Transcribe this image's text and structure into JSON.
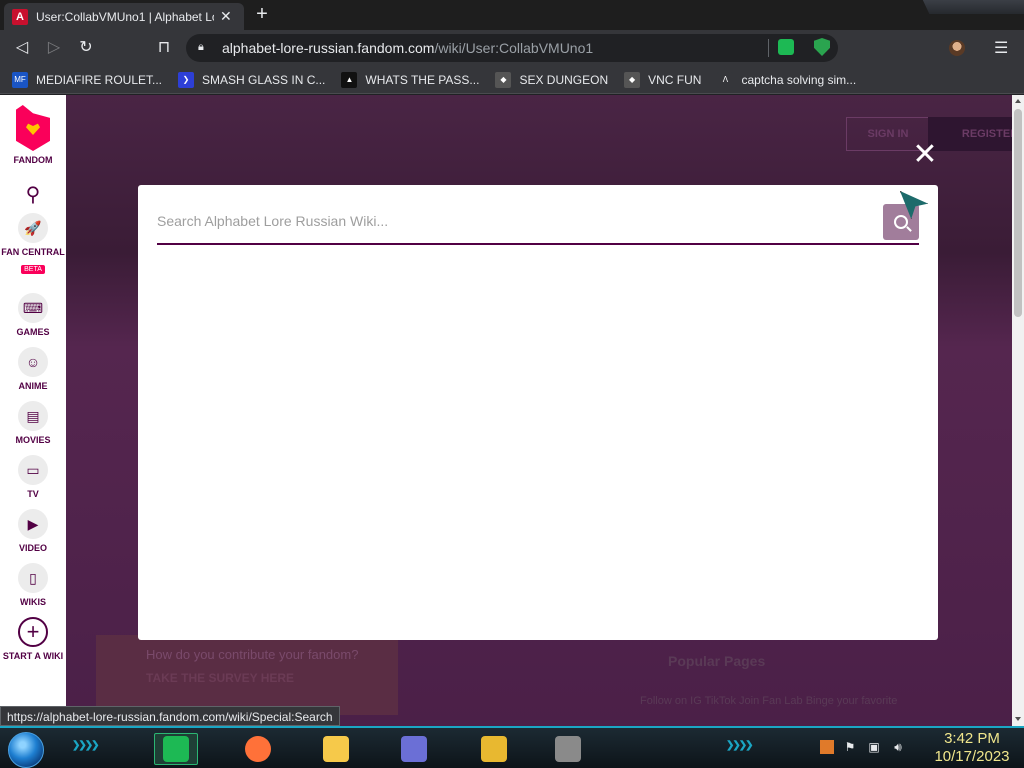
{
  "browser": {
    "tab": {
      "title": "User:CollabVMUno1 | Alphabet Lo",
      "close": "✕",
      "favicon_text": "A"
    },
    "new_tab": "+",
    "url": {
      "domain": "alphabet-lore-russian.fandom.com",
      "path": "/wiki/User:CollabVMUno1"
    },
    "bookmarks": [
      {
        "label": "MEDIAFIRE ROULET...",
        "icon": "mediafire-icon",
        "color": "#1a55c4",
        "icon_text": "MF"
      },
      {
        "label": "SMASH GLASS IN C...",
        "icon": "chevron-icon",
        "color": "#2d3fd6",
        "icon_text": "❯"
      },
      {
        "label": "WHATS THE PASS...",
        "icon": "dark-box-icon",
        "color": "#111111",
        "icon_text": "▲"
      },
      {
        "label": "SEX DUNGEON",
        "icon": "cube-icon",
        "color": "#555555",
        "icon_text": "◆"
      },
      {
        "label": "VNC FUN",
        "icon": "cube-icon",
        "color": "#555555",
        "icon_text": "◆"
      },
      {
        "label": "captcha solving sim...",
        "icon": "a-logo-icon",
        "color": "#35363a",
        "icon_text": "Λ"
      }
    ],
    "status_url": "https://alphabet-lore-russian.fandom.com/wiki/Special:Search"
  },
  "fandom_rail": {
    "logo_label": "FANDOM",
    "items": [
      {
        "label": "FAN CENTRAL",
        "badge": "BETA",
        "icon": "rocket-icon",
        "glyph": "🚀"
      },
      {
        "label": "GAMES",
        "icon": "controller-icon",
        "glyph": "⌨"
      },
      {
        "label": "ANIME",
        "icon": "anime-face-icon",
        "glyph": "☺"
      },
      {
        "label": "MOVIES",
        "icon": "clapper-icon",
        "glyph": "▤"
      },
      {
        "label": "TV",
        "icon": "tv-icon",
        "glyph": "▭"
      },
      {
        "label": "VIDEO",
        "icon": "play-icon",
        "glyph": "▶"
      },
      {
        "label": "WIKIS",
        "icon": "book-icon",
        "glyph": "▯"
      },
      {
        "label": "START A WIKI",
        "icon": "plus-circle-icon",
        "glyph": "+"
      }
    ]
  },
  "background_page": {
    "sign_in": "SIGN IN",
    "register": "REGISTER",
    "survey_question": "How do you contribute your fandom?",
    "survey_link": "TAKE THE SURVEY HERE",
    "popular_pages": "Popular Pages",
    "footer_text": "Follow on IG    TikTok    Join Fan Lab    Binge your favorite"
  },
  "search_modal": {
    "placeholder": "Search Alphabet Lore Russian Wiki...",
    "value": "",
    "close": "✕",
    "accent": "#520044"
  },
  "taskbar": {
    "apps": [
      {
        "name": "notes-app-icon",
        "color": "#1db954",
        "active": true
      },
      {
        "name": "firefox-icon",
        "color": "#ff7139",
        "active": false
      },
      {
        "name": "file-explorer-icon",
        "color": "#f6c94a",
        "active": false
      },
      {
        "name": "id-card-app-icon",
        "color": "#6b6fd6",
        "active": false
      },
      {
        "name": "bee-app-icon",
        "color": "#e8b830",
        "active": false
      },
      {
        "name": "sword-app-icon",
        "color": "#8a8a8a",
        "active": false
      }
    ],
    "time": "3:42 PM",
    "date": "10/17/2023"
  }
}
